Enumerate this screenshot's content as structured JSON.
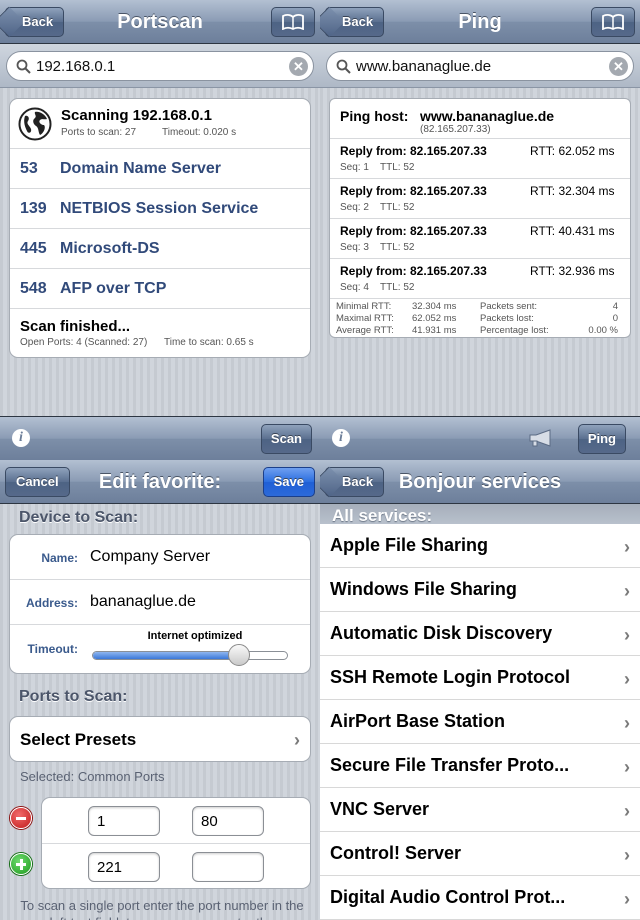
{
  "portscan": {
    "back_label": "Back",
    "title": "Portscan",
    "search_value": "192.168.0.1",
    "status_title": "Scanning 192.168.0.1",
    "ports_to_scan_label": "Ports to scan: 27",
    "timeout_label": "Timeout: 0.020 s",
    "ports": [
      {
        "num": "53",
        "name": "Domain Name Server"
      },
      {
        "num": "139",
        "name": "NETBIOS Session Service"
      },
      {
        "num": "445",
        "name": "Microsoft-DS"
      },
      {
        "num": "548",
        "name": "AFP over TCP"
      }
    ],
    "finished_title": "Scan finished...",
    "open_ports_label": "Open Ports: 4 (Scanned: 27)",
    "time_label": "Time to scan: 0.65 s",
    "scan_button": "Scan"
  },
  "ping": {
    "back_label": "Back",
    "title": "Ping",
    "search_value": "www.bananaglue.de",
    "host_label": "Ping host:",
    "host_value": "www.bananaglue.de",
    "host_ip": "(82.165.207.33)",
    "replies": [
      {
        "from": "Reply from: 82.165.207.33",
        "rtt": "RTT: 62.052 ms",
        "seq": "Seq: 1",
        "ttl": "TTL: 52"
      },
      {
        "from": "Reply from: 82.165.207.33",
        "rtt": "RTT: 32.304 ms",
        "seq": "Seq: 2",
        "ttl": "TTL: 52"
      },
      {
        "from": "Reply from: 82.165.207.33",
        "rtt": "RTT: 40.431 ms",
        "seq": "Seq: 3",
        "ttl": "TTL: 52"
      },
      {
        "from": "Reply from: 82.165.207.33",
        "rtt": "RTT: 32.936 ms",
        "seq": "Seq: 4",
        "ttl": "TTL: 52"
      }
    ],
    "stats": {
      "min_label": "Minimal RTT:",
      "min_value": "32.304 ms",
      "max_label": "Maximal RTT:",
      "max_value": "62.052 ms",
      "avg_label": "Average RTT:",
      "avg_value": "41.931 ms",
      "sent_label": "Packets sent:",
      "sent_value": "4",
      "lost_label": "Packets lost:",
      "lost_value": "0",
      "pct_label": "Percentage lost:",
      "pct_value": "0.00 %"
    },
    "ping_button": "Ping"
  },
  "edit": {
    "cancel_label": "Cancel",
    "title": "Edit favorite:",
    "save_label": "Save",
    "device_header": "Device to Scan:",
    "name_label": "Name:",
    "name_value": "Company Server",
    "address_label": "Address:",
    "address_value": "bananaglue.de",
    "timeout_label": "Timeout:",
    "timeout_setting": "Internet optimized",
    "timeout_slider_level": 0.75,
    "ports_header": "Ports to Scan:",
    "select_presets": "Select Presets",
    "selected_label": "Selected: Common Ports",
    "ranges": [
      {
        "from": "1",
        "to": "80"
      },
      {
        "from": "221",
        "to": ""
      }
    ],
    "hint": "To scan a single port enter the port number in the left text field; to scan a range, enter the"
  },
  "bonjour": {
    "back_label": "Back",
    "title": "Bonjour services",
    "section_header": "All services:",
    "services": [
      "Apple File Sharing",
      "Windows File Sharing",
      "Automatic Disk Discovery",
      "SSH Remote Login Protocol",
      "AirPort Base Station",
      "Secure File Transfer Proto...",
      "VNC Server",
      "Control! Server",
      "Digital Audio Control Prot..."
    ]
  }
}
